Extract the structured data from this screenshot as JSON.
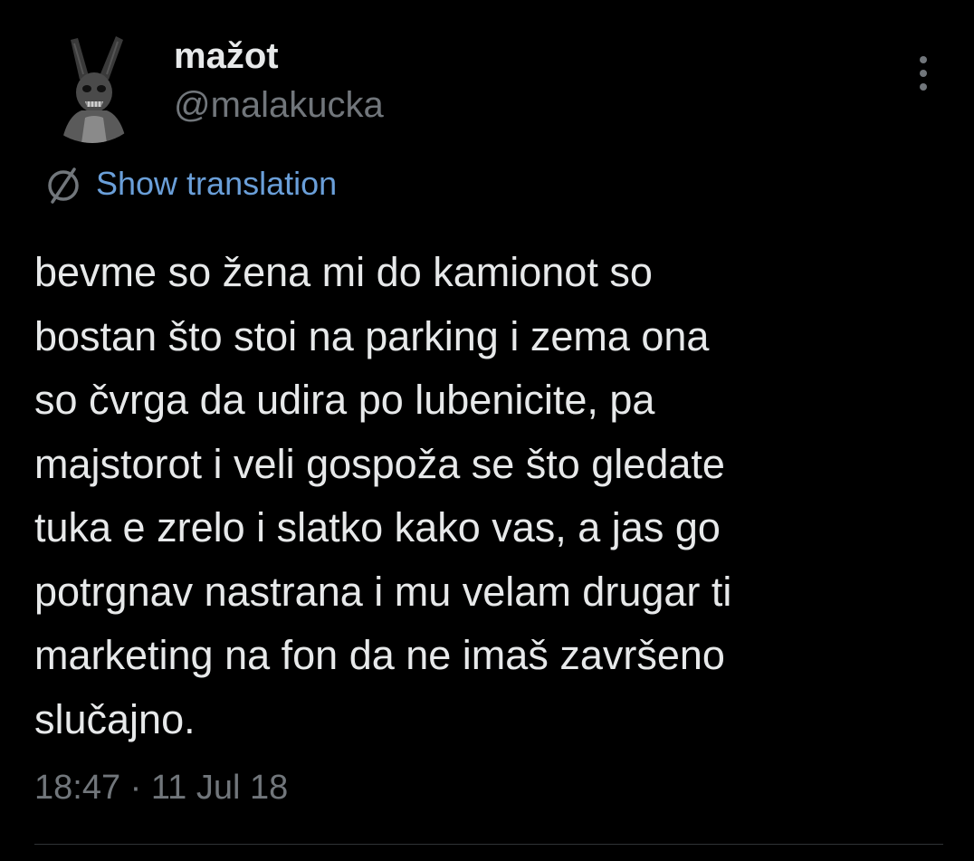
{
  "tweet": {
    "author": {
      "display_name": "mažot",
      "handle": "@malakucka",
      "avatar_icon": "bunny-mask-avatar"
    },
    "more_icon": "more-vertical-icon",
    "translation": {
      "icon": "translate-globe-icon",
      "label": "Show translation",
      "color": "#6a9fd9"
    },
    "text": "bevme so žena mi do kamionot so\nbostan što stoi na parking i zema ona\nso čvrga da udira po lubenicite, pa\nmajstorot i veli gospoža se što gledate\ntuka e zrelo i slatko kako vas, a jas go\npotrgnav nastrana i mu velam drugar ti\nmarketing na fon da ne imaš završeno\nslučajno.",
    "timestamp": "18:47 · 11 Jul 18"
  },
  "colors": {
    "background": "#000000",
    "text": "#e7e9ea",
    "muted": "#71767b",
    "divider": "#2f3336"
  }
}
